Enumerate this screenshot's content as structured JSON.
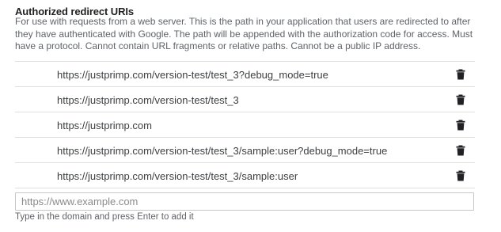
{
  "section": {
    "title": "Authorized redirect URIs",
    "description": "For use with requests from a web server. This is the path in your application that users are redirected to after they have authenticated with Google. The path will be appended with the authorization code for access. Must have a protocol. Cannot contain URL fragments or relative paths. Cannot be a public IP address."
  },
  "uris": [
    {
      "value": "https://justprimp.com/version-test/test_3?debug_mode=true",
      "delete_icon": "trash-icon"
    },
    {
      "value": "https://justprimp.com/version-test/test_3",
      "delete_icon": "trash-icon"
    },
    {
      "value": "https://justprimp.com",
      "delete_icon": "trash-icon"
    },
    {
      "value": "https://justprimp.com/version-test/test_3/sample:user?debug_mode=true",
      "delete_icon": "trash-icon"
    },
    {
      "value": "https://justprimp.com/version-test/test_3/sample:user",
      "delete_icon": "trash-icon"
    }
  ],
  "new_uri": {
    "value": "",
    "placeholder": "https://www.example.com",
    "hint": "Type in the domain and press Enter to add it"
  },
  "colors": {
    "text_primary": "#212121",
    "text_secondary": "#5f6368",
    "divider": "#e0e0e0",
    "input_border": "#c7c7c7",
    "icon": "#202124"
  }
}
